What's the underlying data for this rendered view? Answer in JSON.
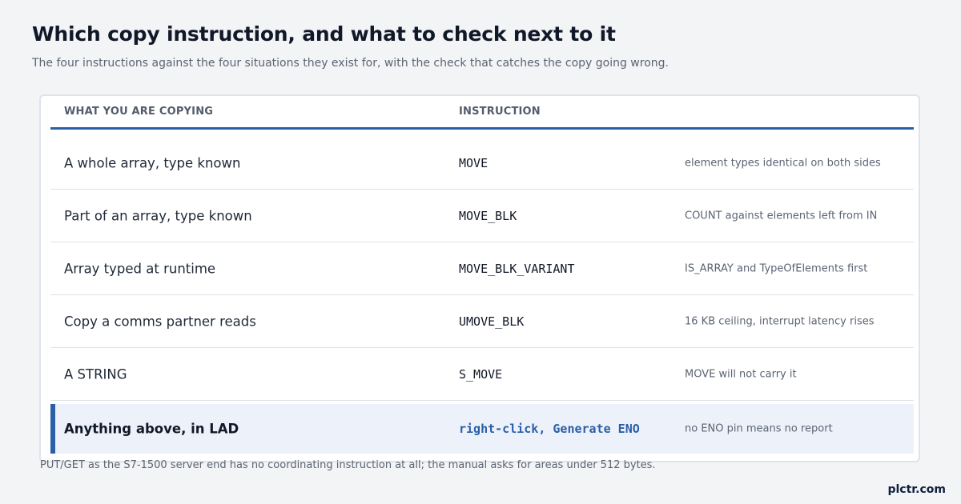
{
  "header": {
    "title": "Which copy instruction, and what to check next to it",
    "subtitle": "The four instructions against the four situations they exist for, with the check that catches the copy going wrong."
  },
  "table": {
    "columns": [
      "WHAT YOU ARE COPYING",
      "INSTRUCTION",
      ""
    ],
    "rows": [
      {
        "situation": "A whole array, type known",
        "instruction": "MOVE",
        "check": "element types identical on both sides"
      },
      {
        "situation": "Part of an array, type known",
        "instruction": "MOVE_BLK",
        "check": "COUNT against elements left from IN"
      },
      {
        "situation": "Array typed at runtime",
        "instruction": "MOVE_BLK_VARIANT",
        "check": "IS_ARRAY and TypeOfElements first"
      },
      {
        "situation": "Copy a comms partner reads",
        "instruction": "UMOVE_BLK",
        "check": "16 KB ceiling, interrupt latency rises"
      },
      {
        "situation": "A STRING",
        "instruction": "S_MOVE",
        "check": "MOVE will not carry it"
      },
      {
        "situation": "Anything above, in LAD",
        "instruction": "right-click, Generate ENO",
        "check": "no ENO pin means no report"
      }
    ]
  },
  "footnote": "PUT/GET as the S7-1500 server end has no coordinating instruction at all; the manual asks for areas under 512 bytes.",
  "brand": "plctr.com",
  "colors": {
    "accent": "#2b5fa8",
    "highlight_row": "#edf2fa",
    "background": "#f3f4f6"
  }
}
